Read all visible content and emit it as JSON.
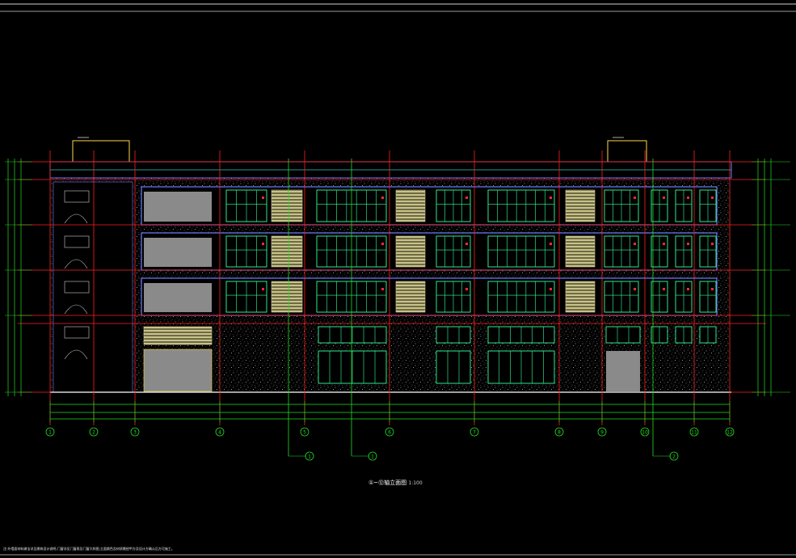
{
  "drawing": {
    "title": "①~⑫轴立面图",
    "scale": "1:100",
    "footnote": "注:外墙面材料做法详见建筑设计说明,门窗详见门窗表及门窗大样图,立面颜色及材质需经甲方及设计方确认后方可施工。",
    "axis_labels": [
      "1",
      "2",
      "3",
      "4",
      "5",
      "6",
      "7",
      "8",
      "9",
      "10",
      "11",
      "12"
    ],
    "section_markers": [
      "1",
      "1",
      "2"
    ],
    "roof_box_labels": [
      "女儿墙",
      "女儿墙"
    ],
    "colors": {
      "background": "#000000",
      "axis_line": "#ff2020",
      "dimension": "#22dd22",
      "window_frame": "#33ff99",
      "stucco": "#bdbdbd",
      "wall_band": "#6f7dff",
      "louver": "#c9c28a",
      "solid_panel": "#8a8a8a",
      "text": "#ffffff"
    }
  }
}
